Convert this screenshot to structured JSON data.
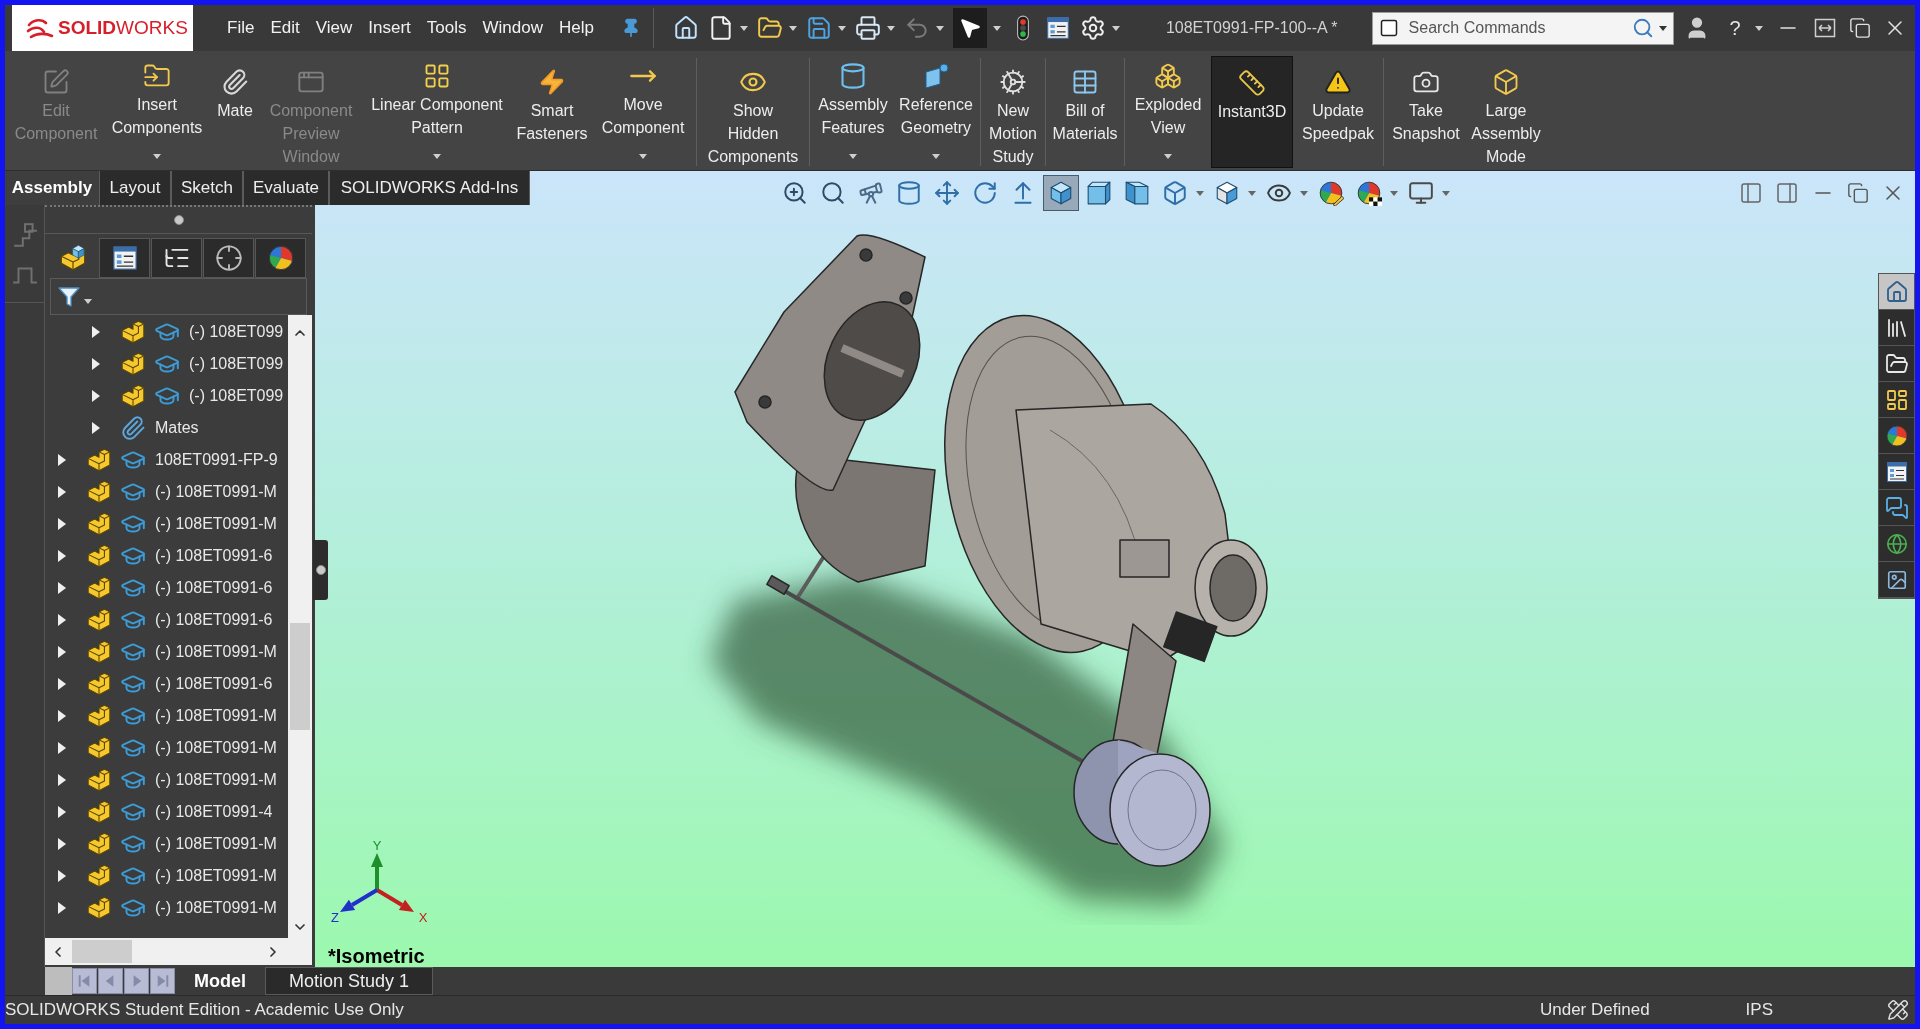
{
  "title_bar": {
    "logo": "**SOLID**WORKS",
    "menu": [
      "File",
      "Edit",
      "View",
      "Insert",
      "Tools",
      "Window",
      "Help"
    ],
    "quick_access": [
      {
        "kind": "button",
        "disabled": false,
        "selected": false
      },
      {
        "kind": "dropdown",
        "disabled": false,
        "selected": false
      },
      {
        "kind": "dropdown",
        "disabled": false,
        "selected": false
      },
      {
        "kind": "dropdown",
        "disabled": false,
        "selected": false
      },
      {
        "kind": "dropdown",
        "disabled": false,
        "selected": false
      },
      {
        "kind": "dropdown",
        "disabled": true,
        "selected": false
      },
      {
        "kind": "dropdown",
        "disabled": false,
        "selected": true
      },
      {
        "kind": "button",
        "disabled": false,
        "selected": false
      },
      {
        "kind": "button",
        "disabled": false,
        "selected": false
      },
      {
        "kind": "dropdown",
        "disabled": false,
        "selected": false
      }
    ],
    "document_title": "108ET0991-FP-100--A *",
    "search": {
      "placeholder": "Search Commands"
    },
    "help": "?"
  },
  "ribbon": {
    "groups": [
      {
        "buttons": [
          {
            "lines": [
              "Edit",
              "Component"
            ],
            "disabled": true,
            "has_dropdown": false,
            "on": false
          },
          {
            "lines": [
              "Insert",
              "Components"
            ],
            "disabled": false,
            "has_dropdown": true,
            "on": false
          },
          {
            "lines": [
              "Mate"
            ],
            "disabled": false,
            "has_dropdown": false,
            "on": false
          },
          {
            "lines": [
              "Component",
              "Preview",
              "Window"
            ],
            "disabled": true,
            "has_dropdown": false,
            "on": false
          },
          {
            "lines": [
              "Linear Component",
              "Pattern"
            ],
            "disabled": false,
            "has_dropdown": true,
            "on": false
          },
          {
            "lines": [
              "Smart",
              "Fasteners"
            ],
            "disabled": false,
            "has_dropdown": false,
            "on": false
          },
          {
            "lines": [
              "Move",
              "Component"
            ],
            "disabled": false,
            "has_dropdown": true,
            "on": false
          }
        ]
      },
      {
        "buttons": [
          {
            "lines": [
              "Show",
              "Hidden",
              "Components"
            ],
            "disabled": false,
            "has_dropdown": false,
            "on": false
          }
        ]
      },
      {
        "buttons": [
          {
            "lines": [
              "Assembly",
              "Features"
            ],
            "disabled": false,
            "has_dropdown": true,
            "on": false
          },
          {
            "lines": [
              "Reference",
              "Geometry"
            ],
            "disabled": false,
            "has_dropdown": true,
            "on": false
          }
        ]
      },
      {
        "buttons": [
          {
            "lines": [
              "New",
              "Motion",
              "Study"
            ],
            "disabled": false,
            "has_dropdown": false,
            "on": false
          }
        ]
      },
      {
        "buttons": [
          {
            "lines": [
              "Bill of",
              "Materials"
            ],
            "disabled": false,
            "has_dropdown": false,
            "on": false
          }
        ]
      },
      {
        "buttons": [
          {
            "lines": [
              "Exploded",
              "View"
            ],
            "disabled": false,
            "has_dropdown": true,
            "on": false
          },
          {
            "lines": [
              "Instant3D"
            ],
            "disabled": false,
            "has_dropdown": false,
            "on": true
          },
          {
            "lines": [
              "Update",
              "Speedpak"
            ],
            "disabled": false,
            "has_dropdown": false,
            "on": false
          }
        ]
      },
      {
        "buttons": [
          {
            "lines": [
              "Take",
              "Snapshot"
            ],
            "disabled": false,
            "has_dropdown": false,
            "on": false
          },
          {
            "lines": [
              "Large",
              "Assembly",
              "Mode"
            ],
            "disabled": false,
            "has_dropdown": false,
            "on": false
          }
        ]
      }
    ]
  },
  "command_tabs": [
    {
      "label": "Assembly",
      "selected": true
    },
    {
      "label": "Layout",
      "selected": false
    },
    {
      "label": "Sketch",
      "selected": false
    },
    {
      "label": "Evaluate",
      "selected": false
    },
    {
      "label": "SOLIDWORKS Add-Ins",
      "selected": false
    }
  ],
  "panel_tabs": [
    {
      "selected": true
    },
    {
      "selected": false
    },
    {
      "selected": false
    },
    {
      "selected": false
    },
    {
      "selected": false
    }
  ],
  "tree": [
    {
      "children": [
        {
          "kind": "part",
          "label": "(-) 108ET099",
          "expanded": false
        },
        {
          "kind": "part",
          "label": "(-) 108ET099",
          "expanded": false
        },
        {
          "kind": "part",
          "label": "(-) 108ET099",
          "expanded": false
        },
        {
          "kind": "mates",
          "label": "Mates",
          "expanded": false
        }
      ]
    },
    {
      "kind": "part",
      "label": "108ET0991-FP-9",
      "expanded": false
    },
    {
      "kind": "part",
      "label": "(-) 108ET0991-M",
      "expanded": false
    },
    {
      "kind": "part",
      "label": "(-) 108ET0991-M",
      "expanded": false
    },
    {
      "kind": "part",
      "label": "(-) 108ET0991-6",
      "expanded": false
    },
    {
      "kind": "part",
      "label": "(-) 108ET0991-6",
      "expanded": false
    },
    {
      "kind": "part",
      "label": "(-) 108ET0991-6",
      "expanded": false
    },
    {
      "kind": "part",
      "label": "(-) 108ET0991-M",
      "expanded": false
    },
    {
      "kind": "part",
      "label": "(-) 108ET0991-6",
      "expanded": false
    },
    {
      "kind": "part",
      "label": "(-) 108ET0991-M",
      "expanded": false
    },
    {
      "kind": "part",
      "label": "(-) 108ET0991-M",
      "expanded": false
    },
    {
      "kind": "part",
      "label": "(-) 108ET0991-M",
      "expanded": false
    },
    {
      "kind": "part",
      "label": "(-) 108ET0991-4",
      "expanded": false
    },
    {
      "kind": "part",
      "label": "(-) 108ET0991-M",
      "expanded": false
    },
    {
      "kind": "part",
      "label": "(-) 108ET0991-M",
      "expanded": false
    },
    {
      "kind": "part",
      "label": "(-) 108ET0991-M",
      "expanded": false
    }
  ],
  "view_toolbar": [
    {
      "kind": "button",
      "selected": false
    },
    {
      "kind": "button",
      "selected": false
    },
    {
      "kind": "button",
      "selected": false
    },
    {
      "kind": "button",
      "selected": false
    },
    {
      "kind": "button",
      "selected": false
    },
    {
      "kind": "button",
      "selected": false
    },
    {
      "kind": "button",
      "selected": false
    },
    {
      "kind": "button",
      "selected": true
    },
    {
      "kind": "button",
      "selected": false
    },
    {
      "kind": "button",
      "selected": false
    },
    {
      "kind": "dropdown",
      "selected": false
    },
    {
      "kind": "dropdown",
      "selected": false
    },
    {
      "kind": "dropdown",
      "selected": false
    },
    {
      "kind": "button",
      "selected": false
    },
    {
      "kind": "dropdown",
      "selected": false
    },
    {
      "kind": "dropdown",
      "selected": false
    }
  ],
  "viewport": {
    "view_name": "*Isometric",
    "triad": [
      {
        "kind": "y",
        "label": "Y"
      },
      {
        "kind": "x",
        "label": "X"
      },
      {
        "kind": "z",
        "label": "Z"
      }
    ]
  },
  "task_pane": [
    {
      "selected": true
    },
    {
      "selected": false
    },
    {
      "selected": false
    },
    {
      "selected": false
    },
    {
      "selected": false
    },
    {
      "selected": false
    },
    {
      "selected": false
    },
    {
      "selected": false
    },
    {
      "selected": false
    }
  ],
  "bottom_tabs": [
    {
      "label": "Model",
      "selected": true
    },
    {
      "label": "Motion Study 1",
      "selected": false
    }
  ],
  "status_bar": {
    "edition": "SOLIDWORKS Student Edition - Academic Use Only",
    "state": "Under Defined",
    "units": "IPS"
  }
}
